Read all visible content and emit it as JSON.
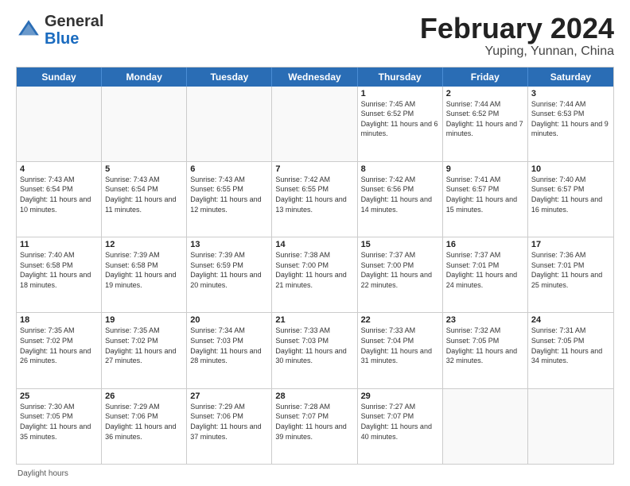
{
  "header": {
    "logo": {
      "general": "General",
      "blue": "Blue",
      "tagline": ""
    },
    "title": "February 2024",
    "location": "Yuping, Yunnan, China"
  },
  "days_of_week": [
    "Sunday",
    "Monday",
    "Tuesday",
    "Wednesday",
    "Thursday",
    "Friday",
    "Saturday"
  ],
  "weeks": [
    [
      {
        "day": "",
        "info": "",
        "empty": true
      },
      {
        "day": "",
        "info": "",
        "empty": true
      },
      {
        "day": "",
        "info": "",
        "empty": true
      },
      {
        "day": "",
        "info": "",
        "empty": true
      },
      {
        "day": "1",
        "info": "Sunrise: 7:45 AM\nSunset: 6:52 PM\nDaylight: 11 hours\nand 6 minutes."
      },
      {
        "day": "2",
        "info": "Sunrise: 7:44 AM\nSunset: 6:52 PM\nDaylight: 11 hours\nand 7 minutes."
      },
      {
        "day": "3",
        "info": "Sunrise: 7:44 AM\nSunset: 6:53 PM\nDaylight: 11 hours\nand 9 minutes."
      }
    ],
    [
      {
        "day": "4",
        "info": "Sunrise: 7:43 AM\nSunset: 6:54 PM\nDaylight: 11 hours\nand 10 minutes."
      },
      {
        "day": "5",
        "info": "Sunrise: 7:43 AM\nSunset: 6:54 PM\nDaylight: 11 hours\nand 11 minutes."
      },
      {
        "day": "6",
        "info": "Sunrise: 7:43 AM\nSunset: 6:55 PM\nDaylight: 11 hours\nand 12 minutes."
      },
      {
        "day": "7",
        "info": "Sunrise: 7:42 AM\nSunset: 6:55 PM\nDaylight: 11 hours\nand 13 minutes."
      },
      {
        "day": "8",
        "info": "Sunrise: 7:42 AM\nSunset: 6:56 PM\nDaylight: 11 hours\nand 14 minutes."
      },
      {
        "day": "9",
        "info": "Sunrise: 7:41 AM\nSunset: 6:57 PM\nDaylight: 11 hours\nand 15 minutes."
      },
      {
        "day": "10",
        "info": "Sunrise: 7:40 AM\nSunset: 6:57 PM\nDaylight: 11 hours\nand 16 minutes."
      }
    ],
    [
      {
        "day": "11",
        "info": "Sunrise: 7:40 AM\nSunset: 6:58 PM\nDaylight: 11 hours\nand 18 minutes."
      },
      {
        "day": "12",
        "info": "Sunrise: 7:39 AM\nSunset: 6:58 PM\nDaylight: 11 hours\nand 19 minutes."
      },
      {
        "day": "13",
        "info": "Sunrise: 7:39 AM\nSunset: 6:59 PM\nDaylight: 11 hours\nand 20 minutes."
      },
      {
        "day": "14",
        "info": "Sunrise: 7:38 AM\nSunset: 7:00 PM\nDaylight: 11 hours\nand 21 minutes."
      },
      {
        "day": "15",
        "info": "Sunrise: 7:37 AM\nSunset: 7:00 PM\nDaylight: 11 hours\nand 22 minutes."
      },
      {
        "day": "16",
        "info": "Sunrise: 7:37 AM\nSunset: 7:01 PM\nDaylight: 11 hours\nand 24 minutes."
      },
      {
        "day": "17",
        "info": "Sunrise: 7:36 AM\nSunset: 7:01 PM\nDaylight: 11 hours\nand 25 minutes."
      }
    ],
    [
      {
        "day": "18",
        "info": "Sunrise: 7:35 AM\nSunset: 7:02 PM\nDaylight: 11 hours\nand 26 minutes."
      },
      {
        "day": "19",
        "info": "Sunrise: 7:35 AM\nSunset: 7:02 PM\nDaylight: 11 hours\nand 27 minutes."
      },
      {
        "day": "20",
        "info": "Sunrise: 7:34 AM\nSunset: 7:03 PM\nDaylight: 11 hours\nand 28 minutes."
      },
      {
        "day": "21",
        "info": "Sunrise: 7:33 AM\nSunset: 7:03 PM\nDaylight: 11 hours\nand 30 minutes."
      },
      {
        "day": "22",
        "info": "Sunrise: 7:33 AM\nSunset: 7:04 PM\nDaylight: 11 hours\nand 31 minutes."
      },
      {
        "day": "23",
        "info": "Sunrise: 7:32 AM\nSunset: 7:05 PM\nDaylight: 11 hours\nand 32 minutes."
      },
      {
        "day": "24",
        "info": "Sunrise: 7:31 AM\nSunset: 7:05 PM\nDaylight: 11 hours\nand 34 minutes."
      }
    ],
    [
      {
        "day": "25",
        "info": "Sunrise: 7:30 AM\nSunset: 7:05 PM\nDaylight: 11 hours\nand 35 minutes."
      },
      {
        "day": "26",
        "info": "Sunrise: 7:29 AM\nSunset: 7:06 PM\nDaylight: 11 hours\nand 36 minutes."
      },
      {
        "day": "27",
        "info": "Sunrise: 7:29 AM\nSunset: 7:06 PM\nDaylight: 11 hours\nand 37 minutes."
      },
      {
        "day": "28",
        "info": "Sunrise: 7:28 AM\nSunset: 7:07 PM\nDaylight: 11 hours\nand 39 minutes."
      },
      {
        "day": "29",
        "info": "Sunrise: 7:27 AM\nSunset: 7:07 PM\nDaylight: 11 hours\nand 40 minutes."
      },
      {
        "day": "",
        "info": "",
        "empty": true
      },
      {
        "day": "",
        "info": "",
        "empty": true
      }
    ]
  ],
  "footer": "Daylight hours"
}
